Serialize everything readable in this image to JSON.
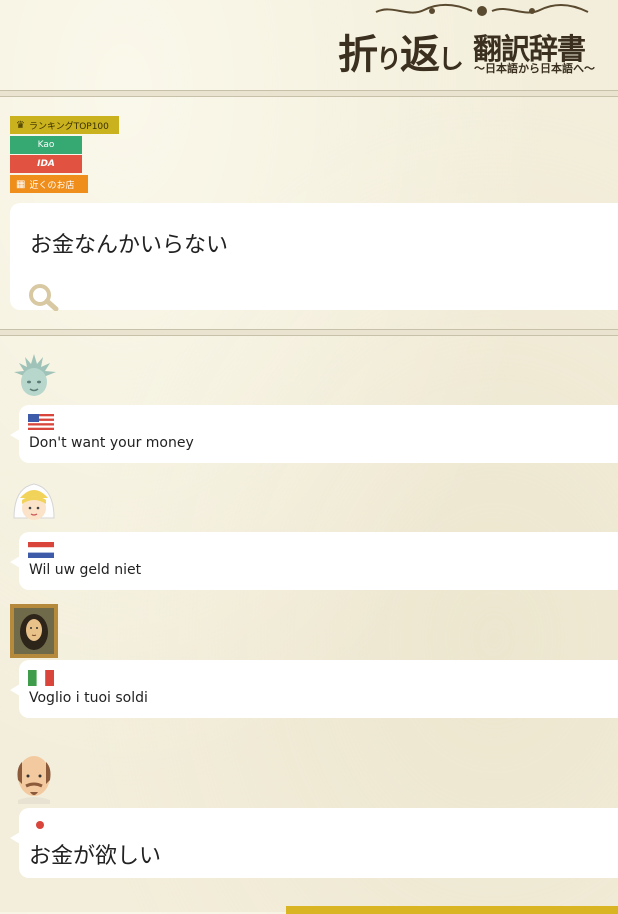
{
  "header": {
    "title_main_a": "折",
    "title_main_b": "り",
    "title_main_c": "返",
    "title_main_d": "し",
    "title_sub": "翻訳辞書",
    "tagline": "〜日本語から日本語へ〜"
  },
  "tags": {
    "ranking": "ランキングTOP100",
    "kao": "Kao",
    "ida": "IDA",
    "near": "近くのお店"
  },
  "input": {
    "text": "お金なんかいらない"
  },
  "translations": [
    {
      "language": "English",
      "flag": "flag-us-icon",
      "avatar": "statue-of-liberty-icon",
      "text": "Don't want your money"
    },
    {
      "language": "Dutch",
      "flag": "flag-nl-icon",
      "avatar": "dutch-girl-icon",
      "text": "Wil uw geld niet"
    },
    {
      "language": "Italian",
      "flag": "flag-it-icon",
      "avatar": "mona-lisa-icon",
      "text": "Voglio i tuoi soldi"
    },
    {
      "language": "Japanese",
      "flag": "flag-jp-icon",
      "avatar": "shakespeare-icon",
      "text": "お金が欲しい"
    }
  ],
  "colors": {
    "background": "#f3eedb",
    "ranking_tag": "#c9b21d",
    "kao_tag": "#36a972",
    "ida_tag": "#e25241",
    "near_tag": "#f08e1c",
    "accent_band": "#d9b524"
  }
}
